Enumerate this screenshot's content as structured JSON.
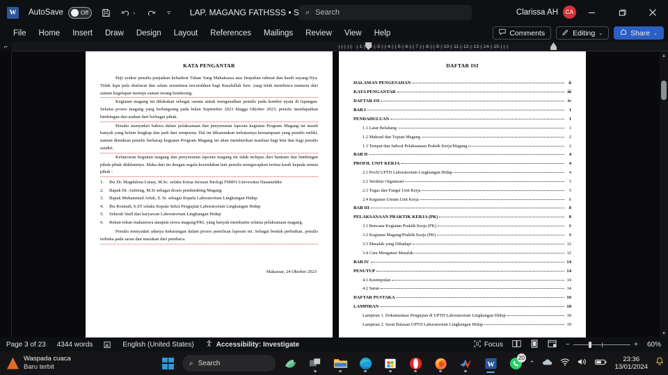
{
  "titlebar": {
    "app_logo": "word-logo",
    "autosave_label": "AutoSave",
    "autosave_state": "Off",
    "save_icon": "save-icon",
    "undo_icon": "undo-icon",
    "redo_icon": "redo-icon",
    "customize_icon": "customize-quick-access-icon",
    "document_title": "LAP. MAGANG FATHSSS • Saved",
    "search_placeholder": "Search",
    "user_name": "Clarissa AH",
    "user_initials": "CA",
    "minimize": "minimize-icon",
    "restore": "restore-icon",
    "close": "close-icon"
  },
  "ribbon": {
    "tabs": [
      {
        "label": "File"
      },
      {
        "label": "Home"
      },
      {
        "label": "Insert"
      },
      {
        "label": "Draw"
      },
      {
        "label": "Design"
      },
      {
        "label": "Layout"
      },
      {
        "label": "References"
      },
      {
        "label": "Mailings"
      },
      {
        "label": "Review"
      },
      {
        "label": "View"
      },
      {
        "label": "Help"
      }
    ],
    "comments_label": "Comments",
    "editing_label": "Editing",
    "share_label": "Share",
    "share_color": "#2b5fc4"
  },
  "ruler": {
    "marks": "·|·|·|·|·|·  ·|·1·|·|·2·|·3·|·|·4·|·|·5·|·6·|·|·7·|·|·8·|·|·9·|·10·|·11·|·12·|·13·|·14·|·15·|·|·|·"
  },
  "document": {
    "left_page": {
      "heading": "KATA PENGANTAR",
      "paragraphs": [
        "Puji syukur penulis panjatkan kehadirat Tuhan Yang Mahakuasa atas limpahan rahmat dan kasih sayang-Nya. Tidak lupa pula shalawat dan salam senantiasa tercurahkan bagi Rasulullah Saw. yang telah membawa manusia dari zaman kegelapan menuju zaman terang benderang.",
        "Kegiatan magang ini dilakukan sebagai sarana untuk mengenalkan penulis pada kondisi nyata di lapangan. Selama proses magang yang berlangsung pada bulan September 2023 hingga Oktober 2023, penulis mendapatkan bimbingan dan arahan dari berbagai pihak.",
        "Penulis menyadari bahwa dalam pelaksanaan dan penyusunan laporan kegiatan Program Magang ini masih banyak yang belum lengkap dan jauh dari sempurna. Hal ini dikarenakan terbatasnya kemampuan yang penulis miliki, namun demikian penulis berharap kegiatan Program Magang ini akan memberikan manfaat bagi kita dan bagi penulis sendiri.",
        "Kelancaran kegiatan magang dan penyusunan laporan magang ini tidak terlepas dari bantuan dan bimbingan pihak-pihak didalamnya. Maka dari itu dengan segala kerendahan hati penulis mengucapkan terima kasih kepada semua pihak :"
      ],
      "acknowledgements": [
        "Ibu Dr. Magdalena Litaay, M.Sc. selaku Ketua Jurusan Biologi FMIPA Universitas Hasanuddin",
        "Bapak Dr. Ambeng, M.Si sebagai dosen pembimbing Magang",
        "Bapak Muhammad Arfah, S. Si. sebagai Kepala Laboratorium Lingkungan Hidup",
        "Ibu Rosmah, S.ST selaku Kepala Seksi Pengujian Laboratorium Lingkungan Hidup",
        "Seluruh Staff dan karyawan Laboratorium Lingkungan Hidup",
        "Rekan-rekan mahasiswa ataupun siswa magang/PKL yang banyak membantu selama pelaksanaan magang."
      ],
      "closing_paragraph": "Penulis menyadari adanya kekurangan dalam proses penulisan laporan ini. Sebagai bentuk perbaikan, penulis terbuka pada saran dan masukan dari pembaca.",
      "signature_line": "Makassar, 24 Oktober 2023"
    },
    "right_page": {
      "heading": "DAFTAR ISI",
      "entries": [
        {
          "label": "HALAMAN PENGESAHAN",
          "page": "ii",
          "level": "bold"
        },
        {
          "label": "KATA PENGANTAR",
          "page": "iii",
          "level": "bold"
        },
        {
          "label": "DAFTAR ISI",
          "page": "iv",
          "level": "bold"
        },
        {
          "label": "BAB I",
          "page": "1",
          "level": "bold"
        },
        {
          "label": "PENDAHULUAN",
          "page": "1",
          "level": "bold"
        },
        {
          "label": "1.1 Latar Belakang",
          "page": "1",
          "level": "sub"
        },
        {
          "label": "1.2 Maksud dan Tujuan Magang",
          "page": "2",
          "level": "sub"
        },
        {
          "label": "1.3 Tempat dan Jadwal Pelaksanaan Praktik Kerja/Magang",
          "page": "2",
          "level": "sub"
        },
        {
          "label": "BAB II",
          "page": "4",
          "level": "bold"
        },
        {
          "label": "PROFIL UNIT KERJA",
          "page": "4",
          "level": "bold"
        },
        {
          "label": "2.1 Profil UPTD Laboratorium Lingkungan Hidup",
          "page": "4",
          "level": "sub"
        },
        {
          "label": "2.2 Struktur Organisasi",
          "page": "5",
          "level": "sub"
        },
        {
          "label": "2.3 Tugas dan Fungsi Unit Kerja",
          "page": "5",
          "level": "sub"
        },
        {
          "label": "2.4 Kegiatan Umum Unit Kerja",
          "page": "6",
          "level": "sub"
        },
        {
          "label": "BAB III",
          "page": "8",
          "level": "bold"
        },
        {
          "label": "PELAKSANAAN PRAKTIK KERJA (PK)",
          "page": "8",
          "level": "bold"
        },
        {
          "label": "3.1 Rencana Kegiatan Praktik Kerja (PK)",
          "page": "8",
          "level": "sub"
        },
        {
          "label": "3.2 Kegiatan Magang/Praktik Kerja (PK)",
          "page": "8",
          "level": "sub"
        },
        {
          "label": "3.3 Masalah yang Dihadapi",
          "page": "12",
          "level": "sub"
        },
        {
          "label": "3.4 Cara Mengatasi Masalah",
          "page": "12",
          "level": "sub"
        },
        {
          "label": "BAB IV",
          "page": "14",
          "level": "bold"
        },
        {
          "label": "PENUTUP",
          "page": "14",
          "level": "bold"
        },
        {
          "label": "4.1 Kesimpulan",
          "page": "14",
          "level": "sub"
        },
        {
          "label": "4.2 Saran",
          "page": "14",
          "level": "sub"
        },
        {
          "label": "DAFTAR PUSTAKA",
          "page": "16",
          "level": "bold"
        },
        {
          "label": "LAMPIRAN",
          "page": "18",
          "level": "bold"
        },
        {
          "label": "Lampiran 1. Dokumentasi Pengujian di UPTD Laboratorium Lingkungan Hidup",
          "page": "18",
          "level": "sub"
        },
        {
          "label": "Lampiran 2. Surat Balasan UPTD Laboratorium Lingkungan Hidup",
          "page": "19",
          "level": "sub"
        }
      ]
    }
  },
  "statusbar": {
    "page_count": "Page 3 of 23",
    "word_count": "4344 words",
    "proofing_icon": "proofing-errors-icon",
    "language": "English (United States)",
    "accessibility_icon": "accessibility-icon",
    "accessibility": "Accessibility: Investigate",
    "focus_label": "Focus",
    "focus_icon": "focus-icon",
    "read_mode_icon": "read-mode-icon",
    "print_layout_icon": "print-layout-icon",
    "web_layout_icon": "web-layout-icon",
    "zoom_out": "−",
    "zoom_in": "+",
    "zoom_level": "60%"
  },
  "taskbar": {
    "weather_title": "Waspada cuaca",
    "weather_subtitle": "Baru terbit",
    "start_icon": "windows-start-icon",
    "search_placeholder": "Search",
    "search_icon": "search-icon",
    "copilot_icon": "copilot-icon",
    "items": [
      {
        "name": "task-view-icon"
      },
      {
        "name": "file-explorer-icon"
      },
      {
        "name": "microsoft-edge-icon"
      },
      {
        "name": "microsoft-store-icon"
      },
      {
        "name": "opera-icon"
      },
      {
        "name": "firefox-icon"
      },
      {
        "name": "matlab-icon"
      },
      {
        "name": "microsoft-word-icon"
      },
      {
        "name": "whatsapp-icon",
        "badge": "20"
      }
    ],
    "tray": {
      "chevron_icon": "show-hidden-icons-icon",
      "onedrive_icon": "onedrive-icon",
      "wifi_icon": "wifi-icon",
      "volume_icon": "volume-icon",
      "battery_icon": "battery-icon",
      "time": "23:36",
      "date": "13/01/2024",
      "notification_icon": "notification-bell-icon"
    }
  }
}
